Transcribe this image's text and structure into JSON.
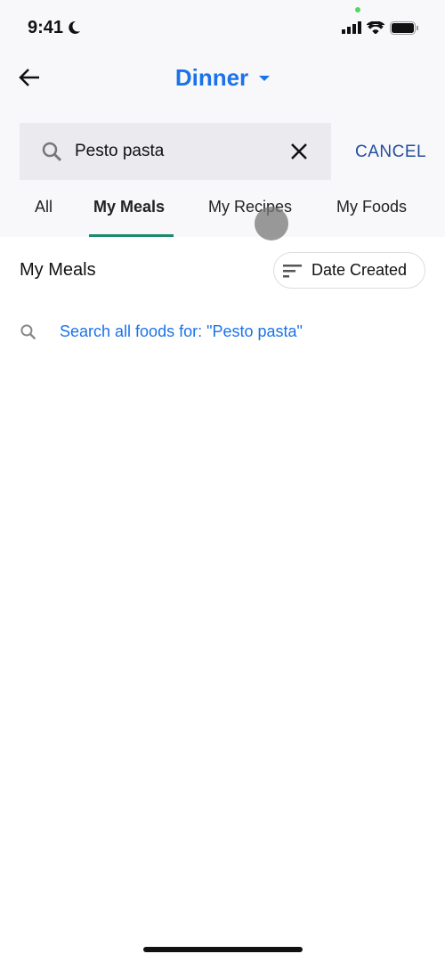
{
  "status_bar": {
    "time": "9:41"
  },
  "header": {
    "title": "Dinner"
  },
  "search": {
    "value": "Pesto pasta",
    "cancel_label": "CANCEL"
  },
  "tabs": [
    {
      "label": "All"
    },
    {
      "label": "My Meals"
    },
    {
      "label": "My Recipes"
    },
    {
      "label": "My Foods"
    }
  ],
  "active_tab": "My Meals",
  "section": {
    "title": "My Meals",
    "sort_label": "Date Created"
  },
  "search_all": {
    "label": "Search all foods for: \"Pesto pasta\""
  },
  "colors": {
    "accent": "#1a73e8",
    "tab_underline": "#1c8a6e",
    "cancel": "#1f4e9c"
  }
}
